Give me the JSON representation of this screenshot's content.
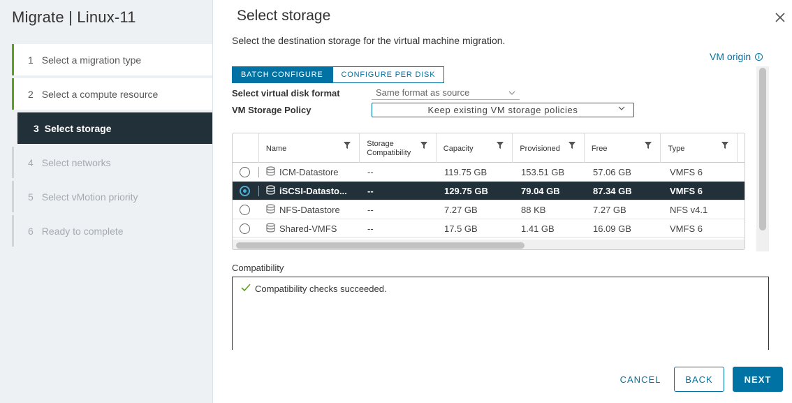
{
  "sidebar": {
    "title": "Migrate | Linux-11",
    "steps": [
      {
        "num": "1",
        "label": "Select a migration type"
      },
      {
        "num": "2",
        "label": "Select a compute resource"
      },
      {
        "num": "3",
        "label": "Select storage"
      },
      {
        "num": "4",
        "label": "Select networks"
      },
      {
        "num": "5",
        "label": "Select vMotion priority"
      },
      {
        "num": "6",
        "label": "Ready to complete"
      }
    ]
  },
  "main": {
    "title": "Select storage",
    "subtitle": "Select the destination storage for the virtual machine migration.",
    "vm_origin": "VM origin",
    "tabs": [
      "BATCH CONFIGURE",
      "CONFIGURE PER DISK"
    ],
    "disk_format_label": "Select virtual disk format",
    "disk_format_value": "Same format as source",
    "policy_label": "VM Storage Policy",
    "policy_value": "Keep existing VM storage policies"
  },
  "table": {
    "columns": [
      "Name",
      "Storage Compatibility",
      "Capacity",
      "Provisioned",
      "Free",
      "Type"
    ],
    "rows": [
      {
        "name": "ICM-Datastore",
        "compat": "--",
        "capacity": "119.75 GB",
        "provisioned": "153.51 GB",
        "free": "57.06 GB",
        "type": "VMFS 6",
        "selected": false
      },
      {
        "name": "iSCSI-Datasto...",
        "compat": "--",
        "capacity": "129.75 GB",
        "provisioned": "79.04 GB",
        "free": "87.34 GB",
        "type": "VMFS 6",
        "selected": true
      },
      {
        "name": "NFS-Datastore",
        "compat": "--",
        "capacity": "7.27 GB",
        "provisioned": "88 KB",
        "free": "7.27 GB",
        "type": "NFS v4.1",
        "selected": false
      },
      {
        "name": "Shared-VMFS",
        "compat": "--",
        "capacity": "17.5 GB",
        "provisioned": "1.41 GB",
        "free": "16.09 GB",
        "type": "VMFS 6",
        "selected": false
      }
    ]
  },
  "compatibility": {
    "label": "Compatibility",
    "message": "Compatibility checks succeeded."
  },
  "buttons": {
    "cancel": "CANCEL",
    "back": "BACK",
    "next": "NEXT"
  },
  "colors": {
    "accent": "#0072a3",
    "selected_row": "#22303a",
    "success": "#5aa220"
  }
}
